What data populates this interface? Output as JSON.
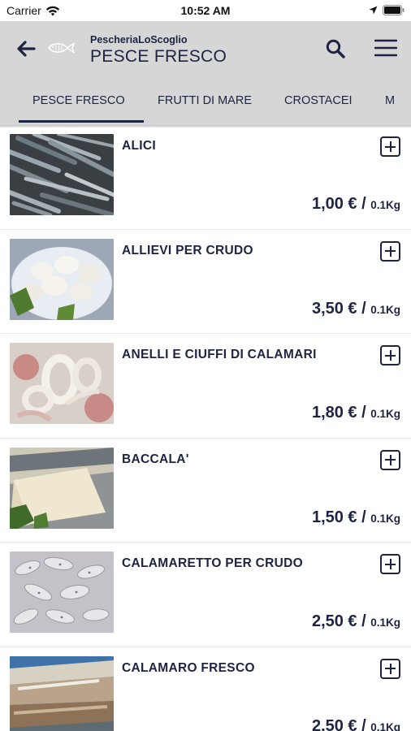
{
  "status_bar": {
    "carrier": "Carrier",
    "time": "10:52 AM"
  },
  "header": {
    "brand": "PescheriaLoScoglio",
    "title": "PESCE FRESCO"
  },
  "tabs": [
    {
      "label": "PESCE FRESCO",
      "active": true
    },
    {
      "label": "FRUTTI DI MARE",
      "active": false
    },
    {
      "label": "CROSTACEI",
      "active": false
    },
    {
      "label": "M",
      "active": false
    }
  ],
  "products": [
    {
      "name": "ALICI",
      "price": "1,00 €",
      "unit": "0.1Kg",
      "image": "anchovies-photo"
    },
    {
      "name": "ALLIEVI PER CRUDO",
      "price": "3,50 €",
      "unit": "0.1Kg",
      "image": "baby-squid-photo"
    },
    {
      "name": "ANELLI E CIUFFI DI CALAMARI",
      "price": "1,80 €",
      "unit": "0.1Kg",
      "image": "squid-rings-photo"
    },
    {
      "name": "BACCALA'",
      "price": "1,50 €",
      "unit": "0.1Kg",
      "image": "salt-cod-photo"
    },
    {
      "name": "CALAMARETTO PER CRUDO",
      "price": "2,50 €",
      "unit": "0.1Kg",
      "image": "small-squid-photo"
    },
    {
      "name": "CALAMARO FRESCO",
      "price": "2,50 €",
      "unit": "0.1Kg",
      "image": "fresh-squid-photo"
    }
  ],
  "colors": {
    "primary": "#1d2340",
    "header_bg": "#d6d6d6"
  }
}
